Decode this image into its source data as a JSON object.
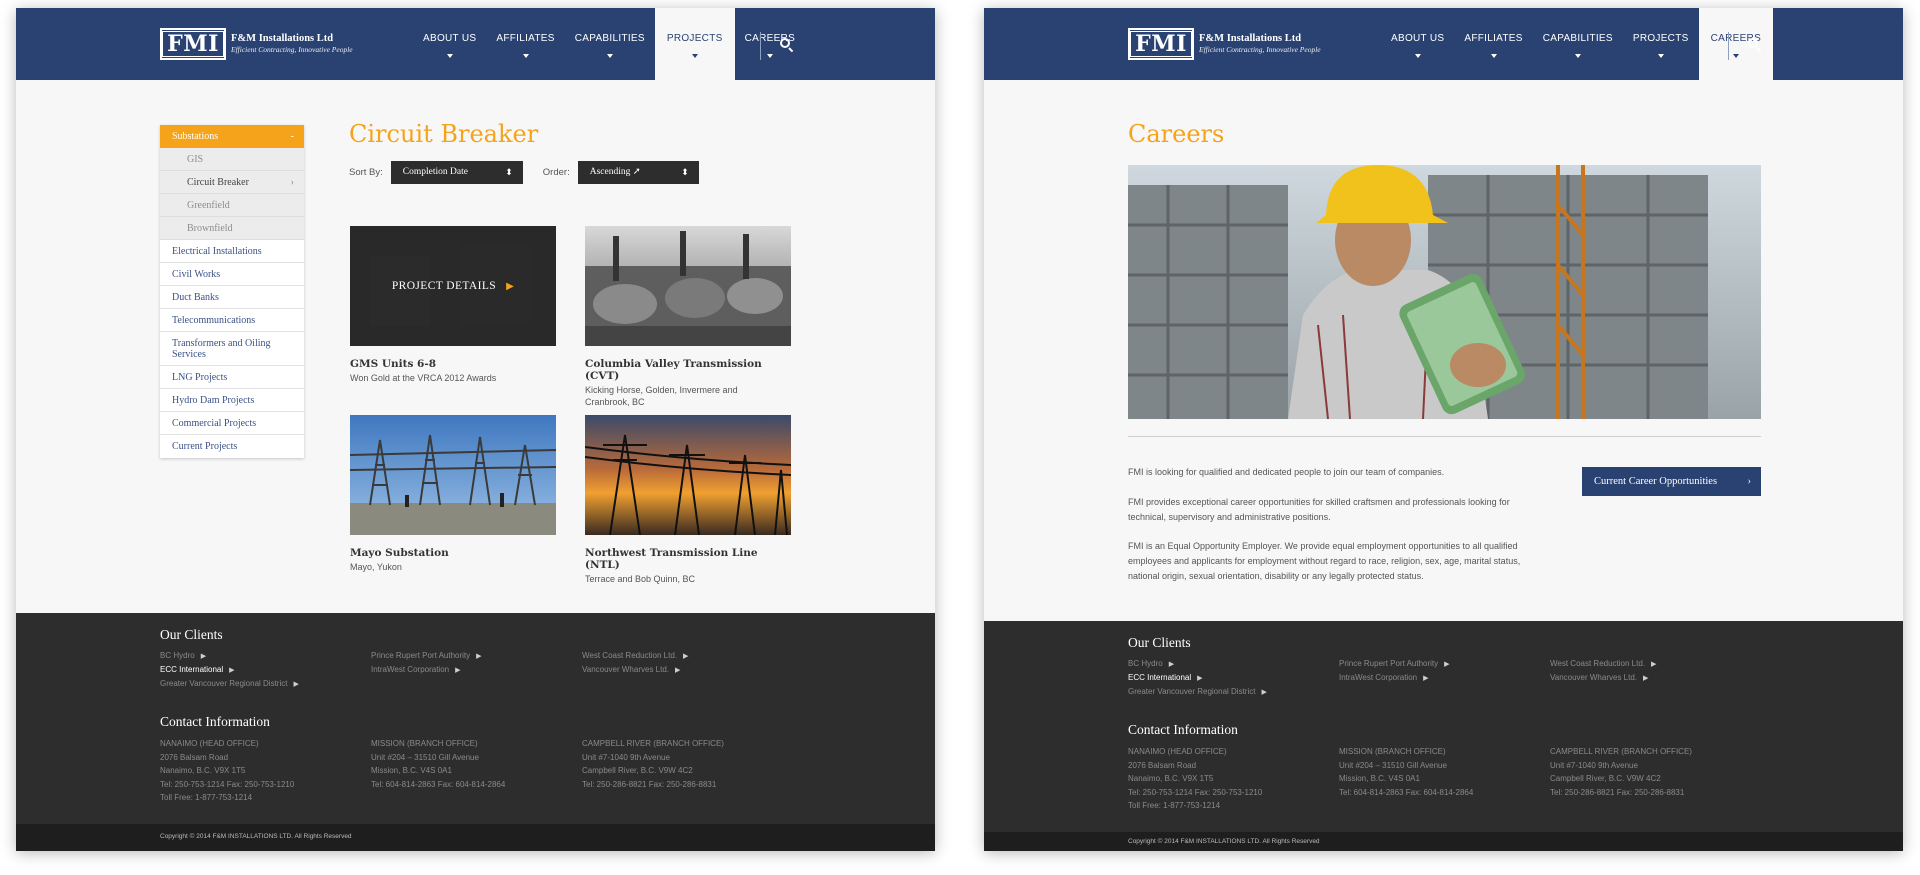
{
  "brand": {
    "logo_mark": "FMI",
    "name": "F&M Installations Ltd",
    "tagline": "Efficient Contracting, Innovative People"
  },
  "nav": [
    {
      "label": "ABOUT US"
    },
    {
      "label": "AFFILIATES"
    },
    {
      "label": "CAPABILITIES"
    },
    {
      "label": "PROJECTS"
    },
    {
      "label": "CAREERS"
    }
  ],
  "colors": {
    "navy": "#2a4272",
    "orange": "#f5a31a",
    "footer": "#2d2d2d"
  },
  "projects_page": {
    "title": "Circuit Breaker",
    "sidebar": {
      "active": {
        "label": "Substations",
        "arrow": "-"
      },
      "sub_items": [
        {
          "label": "GIS"
        },
        {
          "label": "Circuit Breaker",
          "arrow": "›"
        },
        {
          "label": "Greenfield"
        },
        {
          "label": "Brownfield"
        }
      ],
      "items": [
        {
          "label": "Electrical Installations"
        },
        {
          "label": "Civil Works"
        },
        {
          "label": "Duct Banks"
        },
        {
          "label": "Telecommunications"
        },
        {
          "label": "Transformers and Oiling Services"
        },
        {
          "label": "LNG Projects"
        },
        {
          "label": "Hydro Dam Projects"
        },
        {
          "label": "Commercial Projects"
        },
        {
          "label": "Current Projects"
        }
      ]
    },
    "sort": {
      "sort_by_label": "Sort By:",
      "sort_by_value": "Completion Date",
      "order_label": "Order:",
      "order_value": "Ascending ➚",
      "updown": "⬍"
    },
    "cards": [
      {
        "title": "GMS Units 6-8",
        "sub": "Won Gold at the VRCA 2012 Awards",
        "overlay": "PROJECT DETAILS",
        "overlay_arrow": "▶"
      },
      {
        "title": "Columbia Valley Transmission (CVT)",
        "sub": "Kicking Horse, Golden, Invermere and Cranbrook, BC"
      },
      {
        "title": "Mayo Substation",
        "sub": "Mayo, Yukon"
      },
      {
        "title": "Northwest Transmission Line (NTL)",
        "sub": "Terrace and Bob Quinn, BC"
      }
    ]
  },
  "careers_page": {
    "title": "Careers",
    "paragraphs": [
      "FMI is looking for qualified and dedicated people to join our team of companies.",
      "FMI provides exceptional career opportunities for skilled craftsmen and professionals looking for technical, supervisory and administrative positions.",
      "FMI is an Equal Opportunity Employer. We provide equal employment opportunities to all qualified employees and applicants for employment without regard to race, religion, sex, age, marital status, national origin, sexual orientation, disability or any legally protected status."
    ],
    "cta_label": "Current Career Opportunities",
    "cta_arrow": "›"
  },
  "footer": {
    "clients_heading": "Our Clients",
    "clients": [
      "BC Hydro",
      "ECC International",
      "Greater Vancouver Regional District",
      "Prince Rupert Port Authority",
      "IntraWest Corporation",
      "West Coast Reduction Ltd.",
      "Vancouver Wharves Ltd."
    ],
    "client_arrow": "▶",
    "contact_heading": "Contact Information",
    "offices": [
      {
        "name": "NANAIMO (HEAD OFFICE)",
        "line1": "2076 Balsam Road",
        "line2": "Nanaimo, B.C. V9X 1T5",
        "line3": "Tel: 250-753-1214 Fax: 250-753-1210",
        "line4": "Toll Free: 1-877-753-1214"
      },
      {
        "name": "MISSION (BRANCH OFFICE)",
        "line1": "Unit #204 – 31510 Gill Avenue",
        "line2": "Mission, B.C. V4S 0A1",
        "line3": "Tel: 604-814-2863 Fax: 604-814-2864"
      },
      {
        "name": "CAMPBELL RIVER (BRANCH OFFICE)",
        "line1": "Unit #7-1040 9th Avenue",
        "line2": "Campbell River, B.C. V9W 4C2",
        "line3": "Tel: 250-286-8821 Fax: 250-286-8831"
      }
    ],
    "copyright": "Copyright © 2014 F&M INSTALLATIONS LTD. All Rights Reserved"
  }
}
